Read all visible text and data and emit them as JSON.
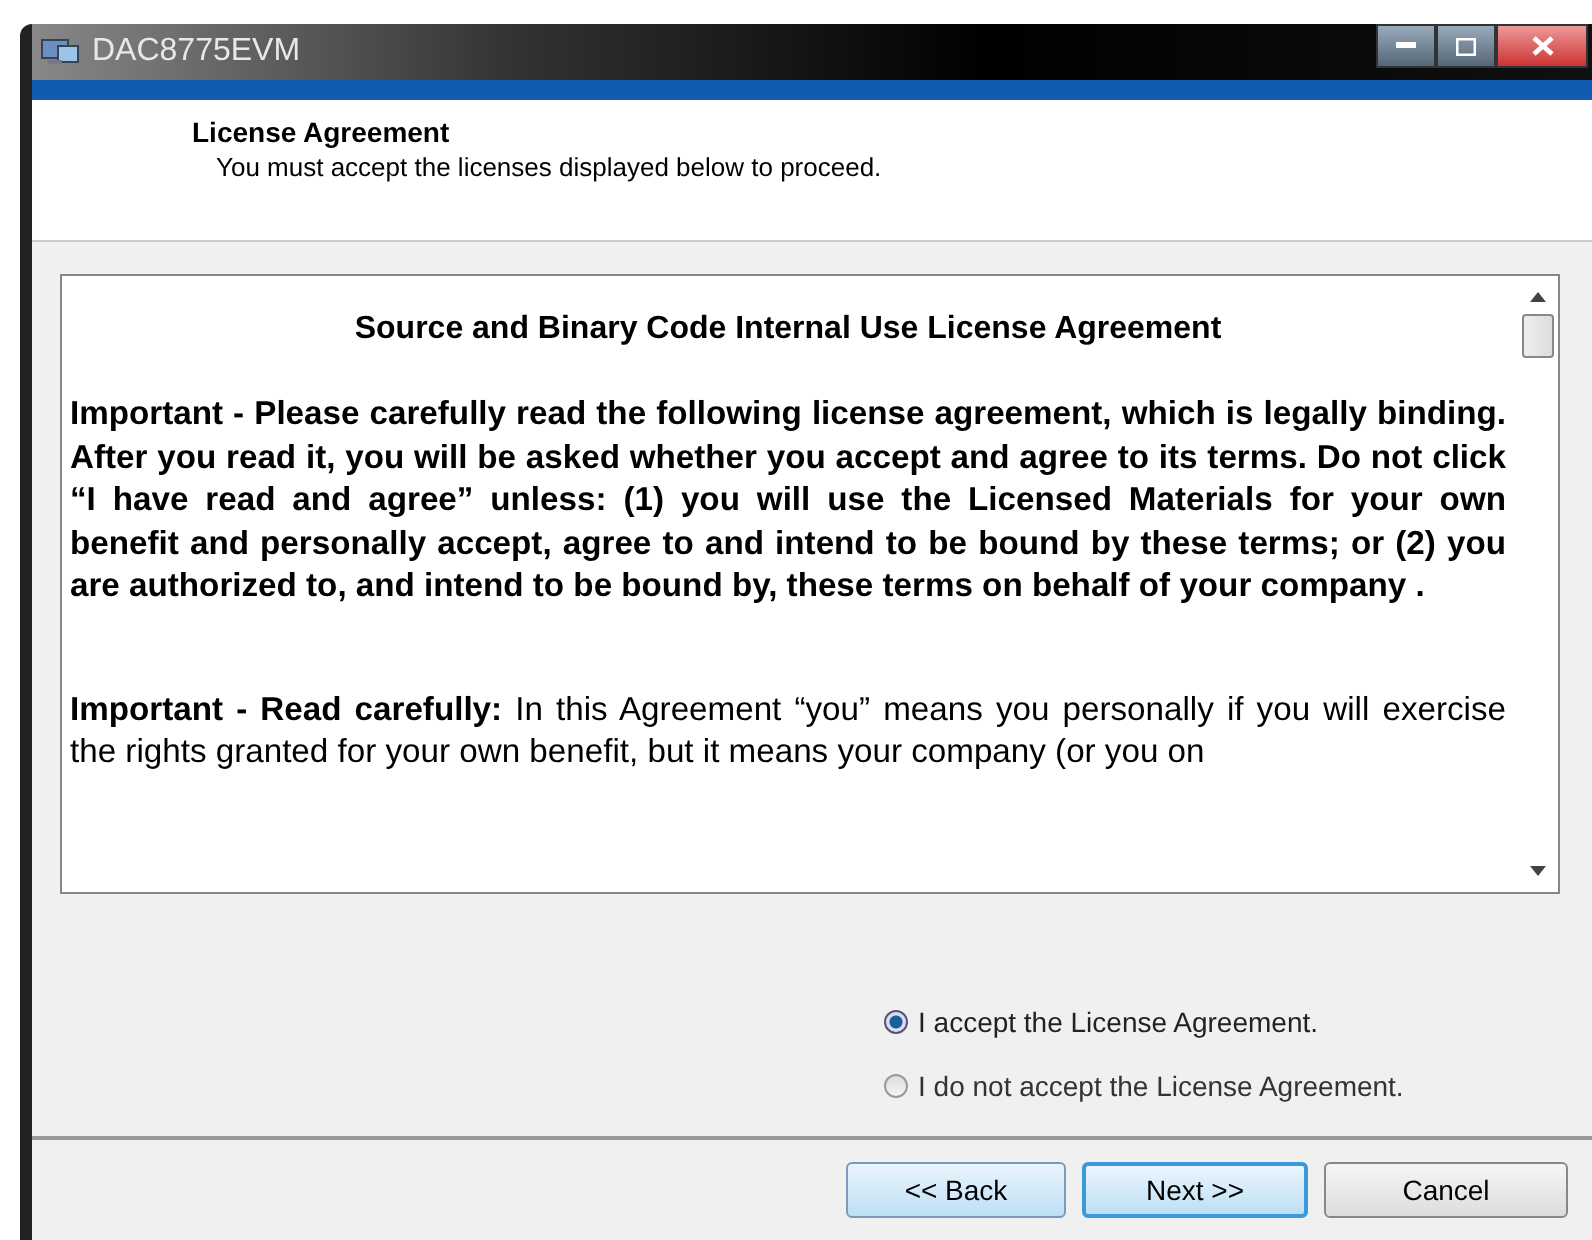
{
  "window": {
    "title": "DAC8775EVM"
  },
  "header": {
    "title": "License Agreement",
    "subtitle": "You must accept the licenses displayed below to proceed."
  },
  "license": {
    "heading": "Source and Binary Code Internal Use License Agreement",
    "paragraphs": [
      {
        "bold": true,
        "text": "Important - Please carefully read the following license agreement, which is legally binding.  After you read it, you will be asked whether you accept and agree to its terms.  Do not click  “I have read and agree” unless: (1) you will use the Licensed Materials for your own benefit and personally accept, agree to and intend to be bound by these terms; or (2) you are authorized to,  and intend to be bound by, these terms on behalf of your company ."
      },
      {
        "bold": false,
        "text": "**Important - Read carefully:** In this Agreement “you” means you personally if you will exercise the rights granted for your own benefit, but it means your company (or you on"
      }
    ]
  },
  "options": [
    {
      "label": "I accept the License Agreement.",
      "selected": true
    },
    {
      "label": "I do not accept the License Agreement.",
      "selected": false
    }
  ],
  "buttons": [
    {
      "label": "<< Back",
      "focused": false
    },
    {
      "label": "Next >>",
      "focused": true
    },
    {
      "label": "Cancel",
      "focused": false
    }
  ]
}
